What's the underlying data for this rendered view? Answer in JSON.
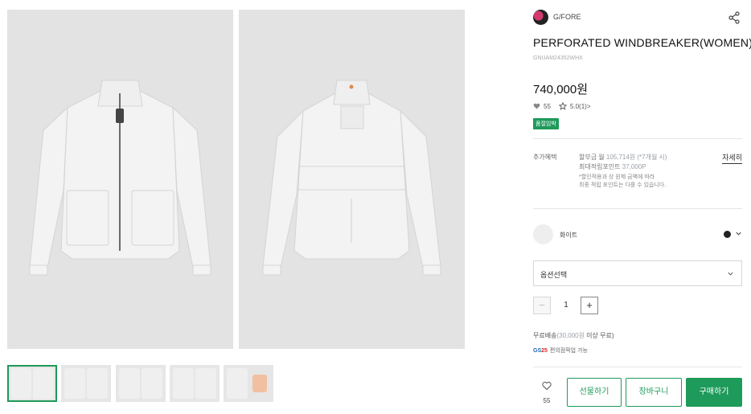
{
  "brand": {
    "name": "G/FORE",
    "logo_icon": "brand-logo"
  },
  "product": {
    "title": "PERFORATED WINDBREAKER(WOMEN)",
    "code": "GNUAM24352WHX",
    "price": "740,000원",
    "likes": "55",
    "rating": "5.0(1)",
    "rating_suffix": ">",
    "badge": "품절임박"
  },
  "benefits": {
    "label": "추가혜택",
    "installment_prefix": "할부금 월 ",
    "installment_value": "105,714원 (*7개월 시)",
    "points_prefix": "최대적립포인트 ",
    "points_value": "37,000P",
    "note_line1": "*할인적용과 상 원제 금액에 따라",
    "note_line2": "최종 적립 포인트는 다를 수 있습니다.",
    "detail_link": "자세히"
  },
  "color": {
    "name": "화이트",
    "swatch": "#eeeeee",
    "dot": "#222222"
  },
  "option_select": {
    "placeholder": "옵션선택"
  },
  "quantity": {
    "value": "1",
    "minus": "−",
    "plus": "+"
  },
  "shipping": {
    "prefix": "무료배송",
    "value": "(30,000원",
    "suffix": " 이상 무료)",
    "pay_logo_a": "GS",
    "pay_logo_b": "25",
    "pay_text": "편의점픽업 가능"
  },
  "actions": {
    "wishlist_count": "55",
    "gift": "선물하기",
    "cart": "장바구니",
    "buy": "구매하기"
  },
  "colors": {
    "accent": "#1e9a5a",
    "photo_bg": "#e3e3e3"
  }
}
